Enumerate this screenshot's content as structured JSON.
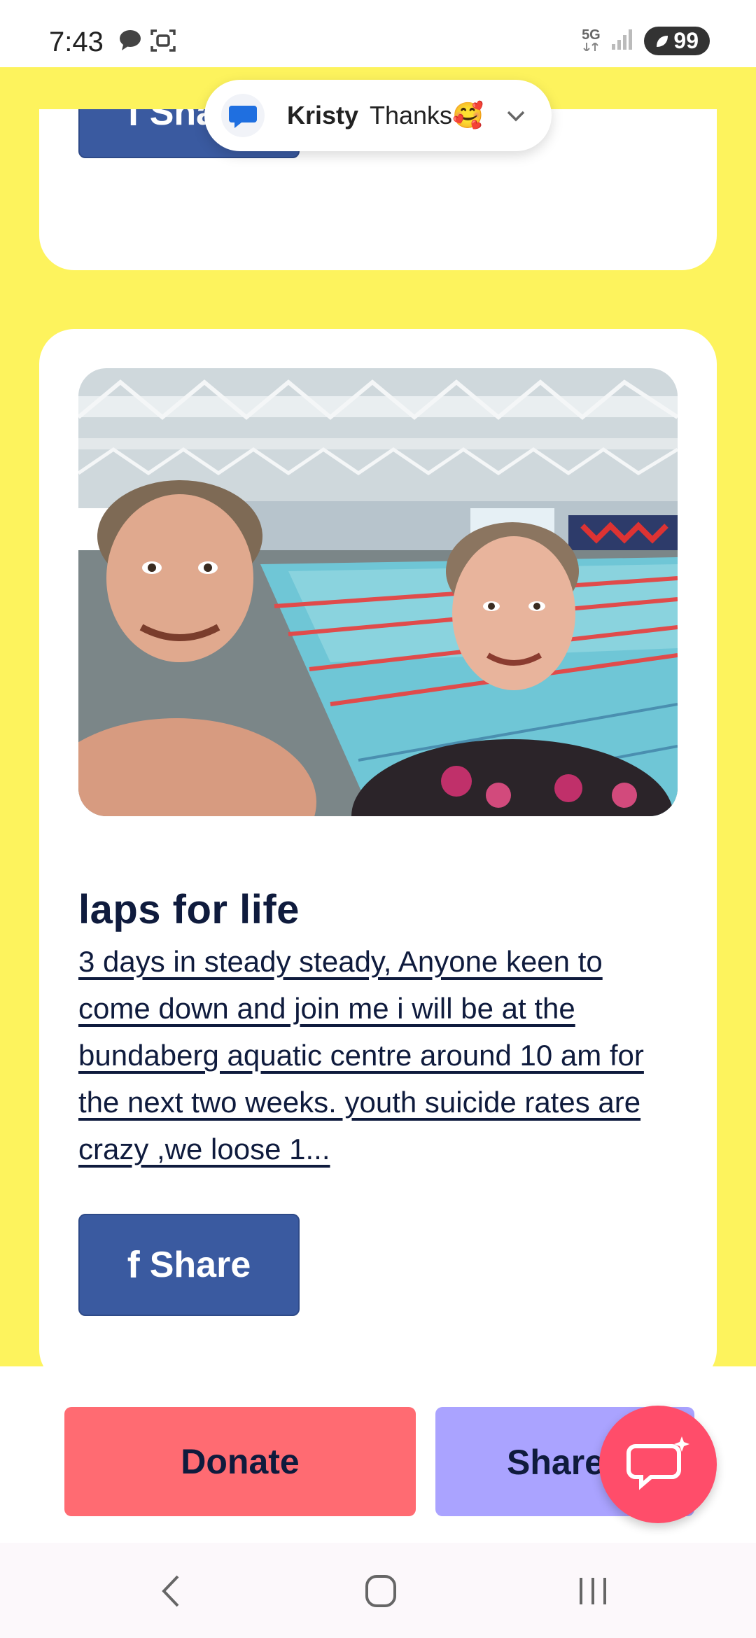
{
  "status_bar": {
    "time": "7:43",
    "network": "5G",
    "battery": "99"
  },
  "notification": {
    "sender": "Kristy",
    "message": "Thanks🥰"
  },
  "top_card": {
    "share_label": "Share"
  },
  "campaign": {
    "title": "laps for life",
    "description": "3 days in steady steady, Anyone keen to come down and join me i will be at the bundaberg aquatic centre around 10 am for the next two weeks. youth suicide rates are crazy ,we loose 1...",
    "share_label": "Share"
  },
  "actions": {
    "donate_label": "Donate",
    "share_label": "Share"
  },
  "colors": {
    "page_background": "#fdf35d",
    "facebook_blue": "#3a5aa0",
    "donate_red": "#ff6b72",
    "share_purple": "#aaa3ff",
    "chat_pink": "#ff4d6a",
    "text_navy": "#0f1b3d"
  },
  "icons": [
    "facebook-icon",
    "chat-icon",
    "back-icon",
    "home-icon",
    "recents-icon",
    "messages-app-icon",
    "chevron-down-icon"
  ]
}
